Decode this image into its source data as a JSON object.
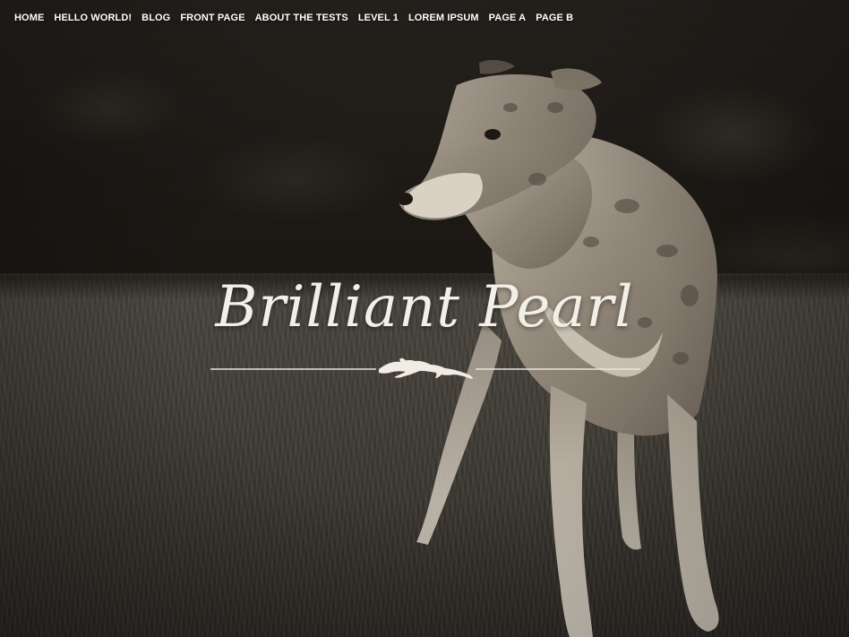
{
  "nav": {
    "items": [
      {
        "label": "HOME"
      },
      {
        "label": "HELLO WORLD!"
      },
      {
        "label": "BLOG"
      },
      {
        "label": "FRONT PAGE"
      },
      {
        "label": "ABOUT THE TESTS"
      },
      {
        "label": "LEVEL 1"
      },
      {
        "label": "LOREM IPSUM"
      },
      {
        "label": "PAGE A"
      },
      {
        "label": "PAGE B"
      }
    ]
  },
  "site": {
    "title": "Brilliant Pearl"
  },
  "colors": {
    "nav_text": "#ffffff",
    "title_text": "#f3efe6",
    "divider": "#e8e4da"
  },
  "icons": {
    "divider_emblem": "running-greyhound-icon"
  }
}
